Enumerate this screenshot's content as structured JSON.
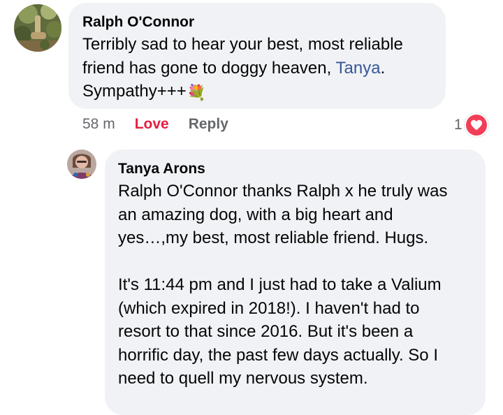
{
  "comments": [
    {
      "author": "Ralph O'Connor",
      "text_part1": "Terribly sad to hear your best, most reliable\nfriend has gone to doggy heaven, ",
      "mention": "Tanya",
      "text_part2": ".\nSympathy+++",
      "emoji": "💐",
      "time": "58 m",
      "reaction_label": "Love",
      "reply_label": "Reply",
      "reaction_count": "1",
      "reaction_icon": "heart-icon"
    },
    {
      "author": "Tanya Arons",
      "text": "Ralph O'Connor thanks Ralph x he truly was\nan amazing dog, with a big heart and\nyes…,my best, most reliable friend.  Hugs.\n\nIt's 11:44 pm and I just had to take a Valium\n(which expired in 2018!). I haven't had to\nresort to that since 2016.  But it's been a\nhorrific day, the past few days actually.  So I\nneed to quell my nervous system."
    }
  ],
  "colors": {
    "bubble": "#f0f2f5",
    "mention": "#385898",
    "love": "#e41e3f",
    "meta": "#65676b",
    "heart": "#f33e58"
  }
}
